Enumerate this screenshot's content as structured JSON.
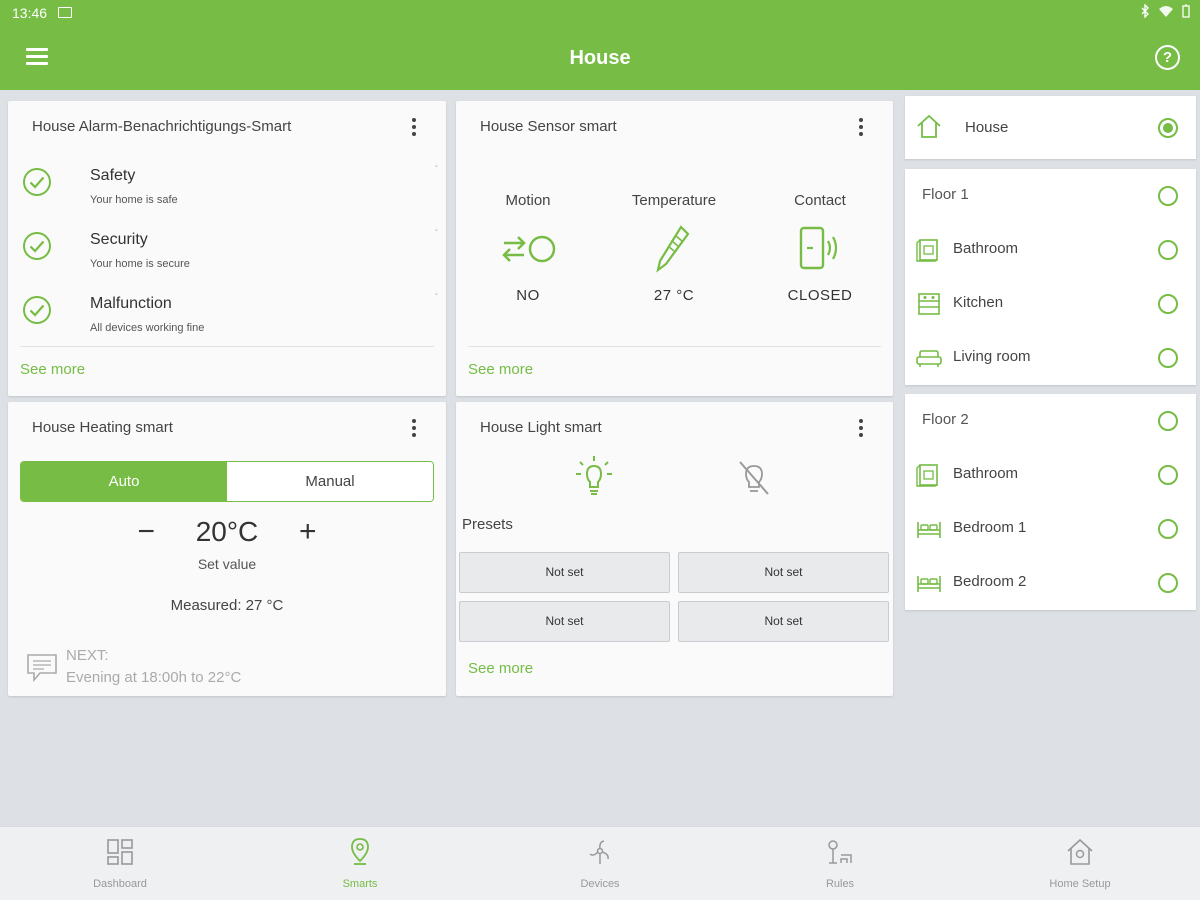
{
  "status_bar": {
    "time": "13:46",
    "image_icon": "image-icon",
    "right_icons": [
      "bluetooth-icon",
      "wifi-icon",
      "battery-icon"
    ]
  },
  "app_bar": {
    "menu_icon": "menu-icon",
    "title": "House",
    "help_icon": "help-icon",
    "help_glyph": "?"
  },
  "colors": {
    "accent": "#76bc45",
    "background": "#dde1e6",
    "card": "#fafafa"
  },
  "alarm_card": {
    "title": "House Alarm-Benachrichtigungs-Smart",
    "items": [
      {
        "name": "Safety",
        "subtitle": "Your home is safe",
        "marker": "-"
      },
      {
        "name": "Security",
        "subtitle": "Your home is secure",
        "marker": "-"
      },
      {
        "name": "Malfunction",
        "subtitle": "All devices working fine",
        "marker": "-"
      }
    ],
    "see_more": "See more"
  },
  "sensor_card": {
    "title": "House Sensor smart",
    "sensors": [
      {
        "label": "Motion",
        "value": "NO",
        "icon": "motion-icon"
      },
      {
        "label": "Temperature",
        "value": "27 °C",
        "icon": "thermometer-icon"
      },
      {
        "label": "Contact",
        "value": "CLOSED",
        "icon": "door-contact-icon"
      }
    ],
    "see_more": "See more"
  },
  "heating_card": {
    "title": "House Heating smart",
    "mode_auto": "Auto",
    "mode_manual": "Manual",
    "active_mode": "Auto",
    "minus": "−",
    "set_value": "20°C",
    "plus": "+",
    "set_value_label": "Set value",
    "measured": "Measured:  27 °C",
    "next_label": "NEXT:",
    "next_value": "Evening at 18:00h to 22°C"
  },
  "light_card": {
    "title": "House Light smart",
    "light_on_icon": "light-on-icon",
    "light_off_icon": "light-off-icon",
    "presets_label": "Presets",
    "presets": [
      "Not set",
      "Not set",
      "Not set",
      "Not set"
    ],
    "see_more": "See more"
  },
  "rooms": {
    "house": {
      "label": "House",
      "icon": "house-icon",
      "selected": true
    },
    "floors": [
      {
        "label": "Floor 1",
        "rooms": [
          {
            "label": "Bathroom",
            "icon": "bathroom-icon"
          },
          {
            "label": "Kitchen",
            "icon": "kitchen-icon"
          },
          {
            "label": "Living room",
            "icon": "sofa-icon"
          }
        ]
      },
      {
        "label": "Floor 2",
        "rooms": [
          {
            "label": "Bathroom",
            "icon": "bathroom-icon"
          },
          {
            "label": "Bedroom 1",
            "icon": "bed-icon"
          },
          {
            "label": "Bedroom 2",
            "icon": "bed-icon"
          }
        ]
      }
    ]
  },
  "bottom_nav": [
    {
      "label": "Dashboard",
      "icon": "dashboard-icon",
      "active": false
    },
    {
      "label": "Smarts",
      "icon": "smarts-icon",
      "active": true
    },
    {
      "label": "Devices",
      "icon": "devices-icon",
      "active": false
    },
    {
      "label": "Rules",
      "icon": "rules-icon",
      "active": false
    },
    {
      "label": "Home Setup",
      "icon": "home-setup-icon",
      "active": false
    }
  ]
}
